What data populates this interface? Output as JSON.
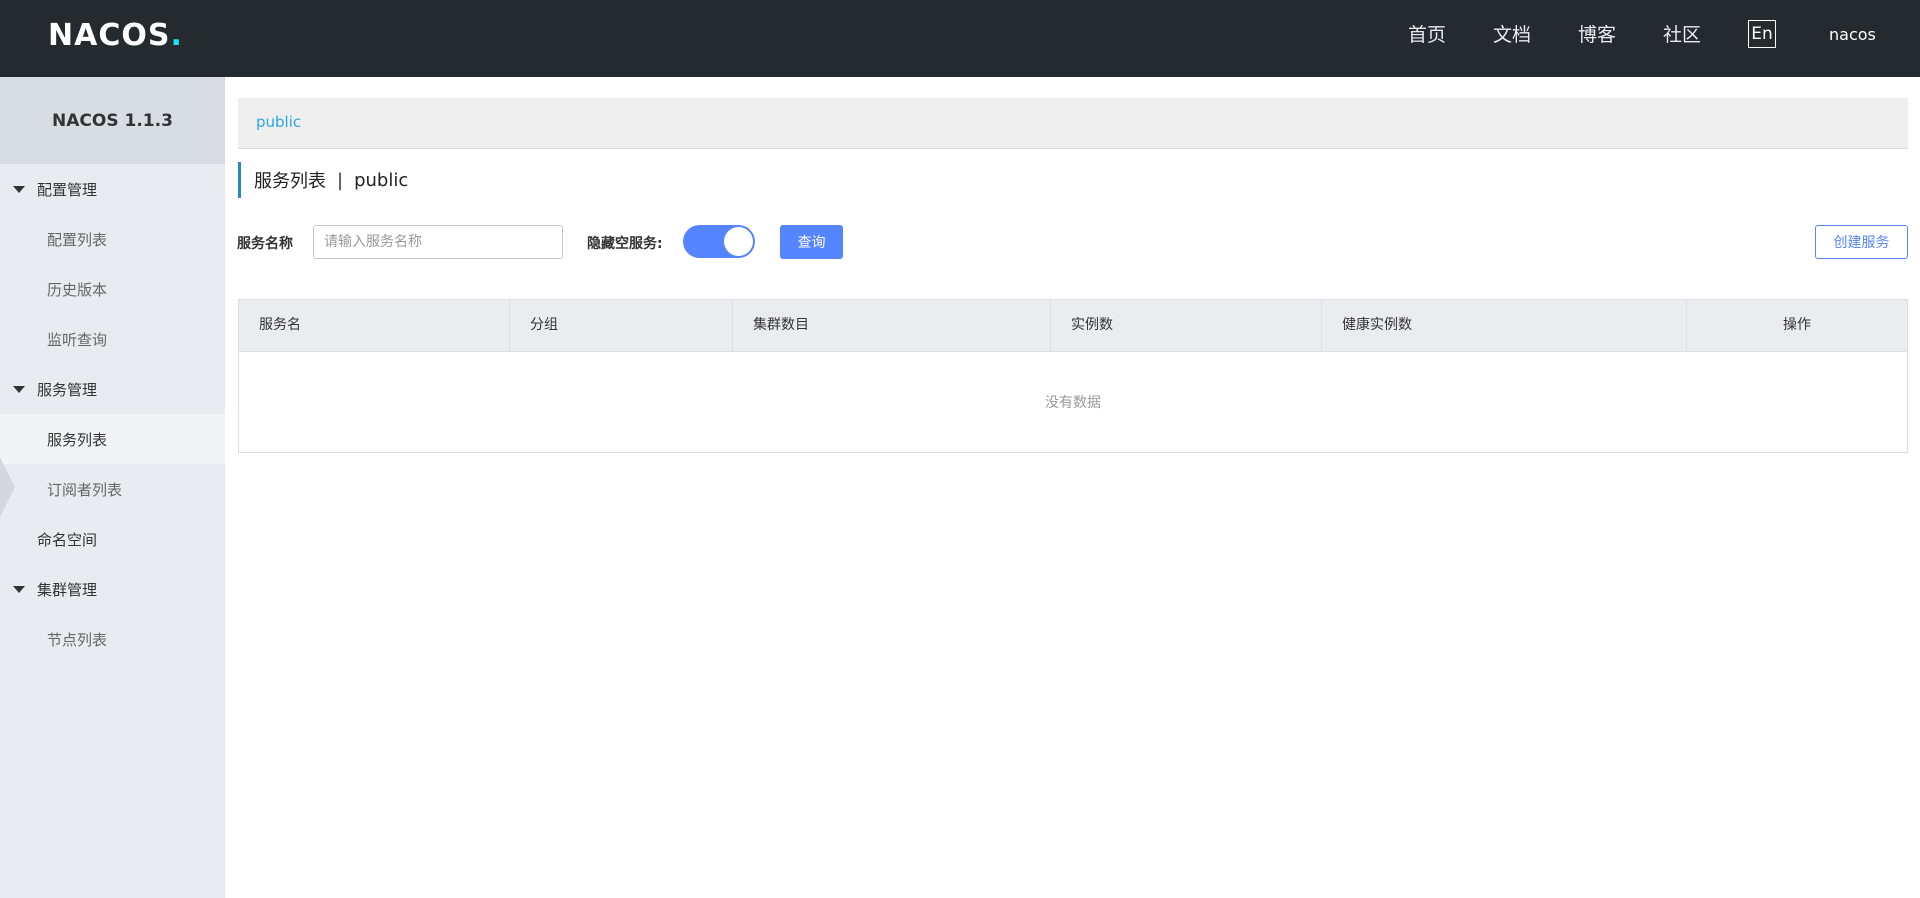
{
  "header": {
    "logo_text": "NACOS",
    "nav": [
      "首页",
      "文档",
      "博客",
      "社区"
    ],
    "lang": "En",
    "user": "nacos"
  },
  "sidebar": {
    "version": "NACOS 1.1.3",
    "groups": [
      {
        "label": "配置管理",
        "items": [
          "配置列表",
          "历史版本",
          "监听查询"
        ]
      },
      {
        "label": "服务管理",
        "items": [
          "服务列表",
          "订阅者列表"
        ]
      },
      {
        "label": "命名空间"
      },
      {
        "label": "集群管理",
        "items": [
          "节点列表"
        ]
      }
    ],
    "active_item": "服务列表"
  },
  "main": {
    "namespace_tab": "public",
    "title": "服务列表",
    "title_sep": "|",
    "title_namespace": "public",
    "filters": {
      "service_name_label": "服务名称",
      "service_name_placeholder": "请输入服务名称",
      "hide_empty_label": "隐藏空服务:",
      "hide_empty_on": true,
      "query_label": "查询",
      "create_label": "创建服务"
    },
    "table": {
      "columns": [
        "服务名",
        "分组",
        "集群数目",
        "实例数",
        "健康实例数",
        "操作"
      ],
      "rows": [],
      "empty_text": "没有数据"
    }
  },
  "colors": {
    "topbar": "#252a2f",
    "primary": "#5584ff",
    "link": "#2ca7e0",
    "sidebar": "#e8ebf0"
  }
}
